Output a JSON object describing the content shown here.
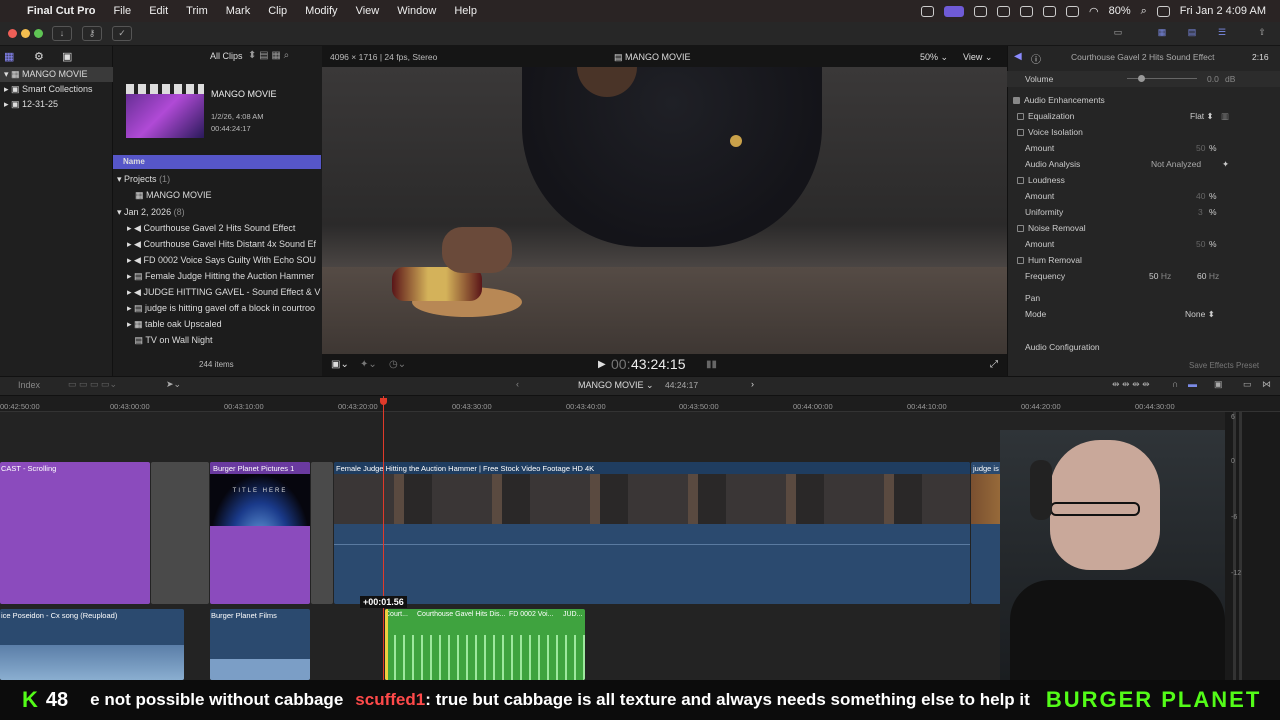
{
  "menubar": {
    "app": "Final Cut Pro",
    "items": [
      "File",
      "Edit",
      "Trim",
      "Mark",
      "Clip",
      "Modify",
      "View",
      "Window",
      "Help"
    ],
    "battery": "80%",
    "datetime": "Fri Jan 2  4:09 AM"
  },
  "browser": {
    "filter": "All Clips",
    "libraries": [
      "MANGO MOVIE",
      "Smart Collections",
      "12-31-25"
    ],
    "event": {
      "title": "MANGO MOVIE",
      "date": "1/2/26, 4:08 AM",
      "duration": "00:44:24:17"
    },
    "column_header": "Name",
    "projects_group": "Projects",
    "projects_count": "(1)",
    "project_name": "MANGO MOVIE",
    "date_group": "Jan 2, 2026",
    "date_count": "(8)",
    "clips": [
      "Courthouse Gavel 2 Hits Sound Effect",
      "Courthouse Gavel Hits Distant 4x Sound Ef",
      "FD 0002   Voice Says Guilty With Echo SOU",
      "Female Judge Hitting the Auction Hammer",
      "JUDGE HITTING GAVEL - Sound Effect & V",
      "judge is hitting gavel off a block in courtroo",
      "table oak Upscaled",
      "TV on Wall Night"
    ],
    "item_count": "244 items"
  },
  "viewer": {
    "format": "4096 × 1716 | 24 fps, Stereo",
    "title": "MANGO MOVIE",
    "zoom": "50%",
    "view": "View",
    "timecode_dim": "00:",
    "timecode": "43:24:15"
  },
  "inspector": {
    "clip_title": "Courthouse Gavel 2 Hits Sound Effect",
    "duration": "2:16",
    "volume_label": "Volume",
    "volume_value": "0.0",
    "volume_unit": "dB",
    "enh": "Audio Enhancements",
    "eq": "Equalization",
    "eq_val": "Flat",
    "voice_iso": "Voice Isolation",
    "amount": "Amount",
    "amount_val": "50",
    "pct": "%",
    "analysis": "Audio Analysis",
    "analysis_val": "Not Analyzed",
    "loudness": "Loudness",
    "loud_amount": "40",
    "uniformity": "Uniformity",
    "uni_val": "3",
    "noise": "Noise Removal",
    "noise_amount": "50",
    "hum": "Hum Removal",
    "frequency": "Frequency",
    "f50": "50",
    "f60": "60",
    "hz": "Hz",
    "pan": "Pan",
    "mode": "Mode",
    "mode_val": "None",
    "config": "Audio Configuration",
    "save": "Save Effects Preset"
  },
  "timeline": {
    "index": "Index",
    "project": "MANGO MOVIE",
    "duration": "44:24:17",
    "ticks": [
      "00:42:50:00",
      "00:43:00:00",
      "00:43:10:00",
      "00:43:20:00",
      "00:43:30:00",
      "00:43:40:00",
      "00:43:50:00",
      "00:44:00:00",
      "00:44:10:00",
      "00:44:20:00",
      "00:44:30:00"
    ],
    "clips": {
      "c1": "CAST - Scrolling",
      "c2": "Burger Planet Pictures 1",
      "c2title": "TITLE HERE",
      "c3": "Female Judge Hitting the Auction Hammer  |  Free Stock Video Footage HD 4K",
      "c4": "judge is hitting gavel of...",
      "a1": "ice Poseidon - Cx song (Reupload)",
      "a2": "Burger Planet Films",
      "a3": "Court...",
      "a4": "Courthouse Gavel Hits Dis...",
      "a5": "FD 0002   Voi...",
      "a6": "JUD..."
    },
    "offset": "+00:01.56",
    "meter": [
      "6",
      "0",
      "-6",
      "-12"
    ]
  },
  "chat": {
    "k": "K",
    "num": "48",
    "msg1": "e not possible without cabbage",
    "user": "scuffed1",
    "msg2": ": true but cabbage is all texture and always needs something else to help it",
    "brand": "BURGER PLANET"
  },
  "colors": {
    "accent": "#5b5bd6",
    "purple_clip": "#8b4bbd",
    "blue_clip": "#2b4a6f",
    "green_audio": "#3fa33f",
    "playhead": "#e03a2a"
  }
}
